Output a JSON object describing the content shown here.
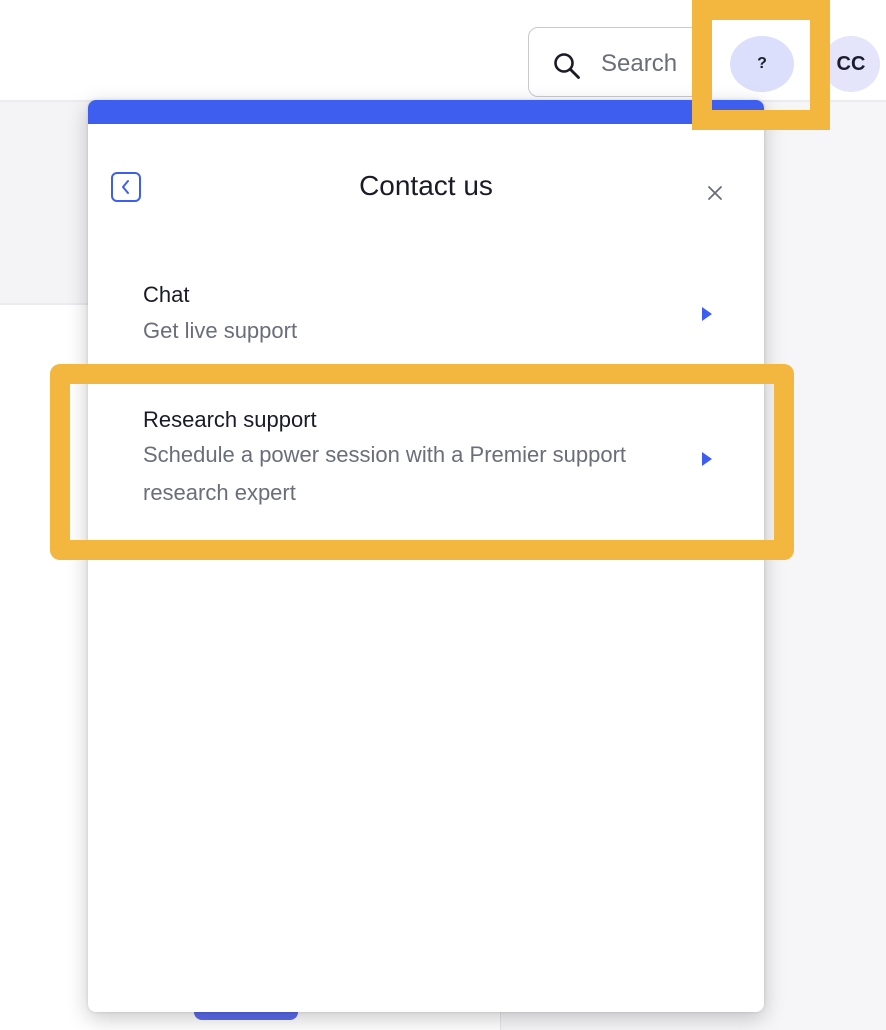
{
  "toolbar": {
    "search_label": "Search",
    "help_label": "?",
    "avatar_initials": "CC"
  },
  "contact_panel": {
    "title": "Contact us",
    "options": [
      {
        "title": "Chat",
        "description": "Get live support"
      },
      {
        "title": "Research support",
        "description": "Schedule a power session with a Premier support research expert"
      }
    ]
  },
  "icons": {
    "search": "search-icon",
    "back": "chevron-left-icon",
    "close": "close-icon",
    "arrow": "caret-right-icon"
  },
  "colors": {
    "accent": "#3e5ef0",
    "highlight": "#f3b63e",
    "help_bg": "#dcdffb",
    "avatar_bg": "#e4e4fb"
  }
}
